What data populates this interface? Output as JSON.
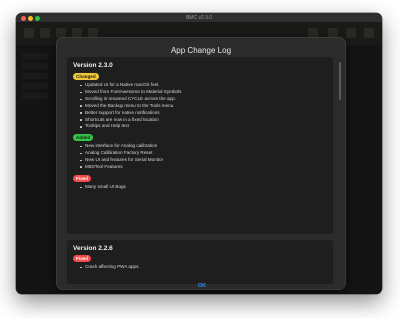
{
  "window": {
    "title": "BMC v2.3.0"
  },
  "dialog": {
    "title": "App Change Log",
    "ok_label": "OK",
    "versions": [
      {
        "version": "Version 2.3.0",
        "sections": [
          {
            "label": "Changed",
            "color": "#f0c73a",
            "items": [
              "Updated UI for a Native macOS feel.",
              "Moved from FontAwesome to Material Symbols",
              "Scrolling is renamed CYCLE across the app.",
              "Moved the Backup menu to the Tools menu.",
              "Better support for native notifications",
              "Shortcuts are now in a fixed location",
              "Tooltips and Help text"
            ]
          },
          {
            "label": "Added",
            "color": "#37c24a",
            "items": [
              "New interface for Analog calibration",
              "Analog Calibration Factory Reset",
              "New UI and features for Serial Monitor",
              "MIDITool Features"
            ]
          },
          {
            "label": "Fixed",
            "color": "#f04a4a",
            "items": [
              "Many small UI Bugs"
            ]
          }
        ]
      },
      {
        "version": "Version 2.2.6",
        "sections": [
          {
            "label": "Fixed",
            "color": "#f04a4a",
            "items": [
              "Crash affecting PWA apps."
            ]
          }
        ]
      }
    ]
  }
}
